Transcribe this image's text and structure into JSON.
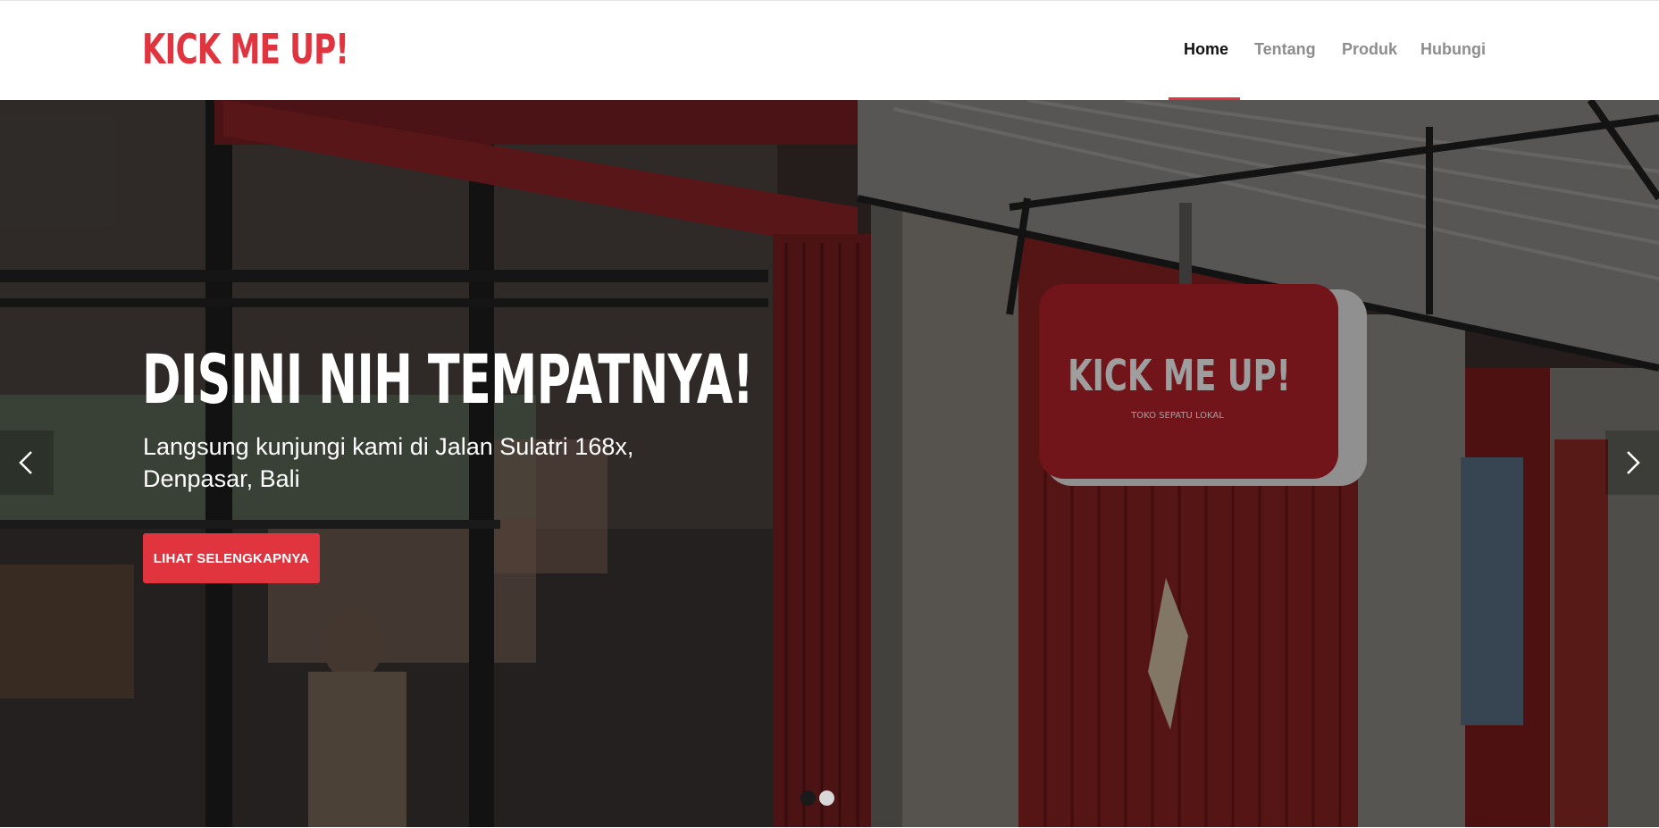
{
  "brand": {
    "logo_text": "KICK ME UP!",
    "accent_color": "#e0343f"
  },
  "nav": {
    "items": [
      {
        "label": "Home",
        "active": true
      },
      {
        "label": "Tentang",
        "active": false
      },
      {
        "label": "Produk",
        "active": false
      },
      {
        "label": "Hubungi",
        "active": false
      }
    ]
  },
  "hero": {
    "title": "DISINI NIH TEMPATNYA!",
    "description": "Langsung kunjungi kami di Jalan Sulatri 168x, Denpasar, Bali",
    "button_label": "LIHAT SELENGKAPNYA",
    "sign_text": "KICK ME UP!",
    "sign_subtext": "TOKO SEPATU LOKAL",
    "prev_icon": "chevron-left-icon",
    "next_icon": "chevron-right-icon",
    "slides": {
      "count": 2,
      "active_index": 0
    }
  }
}
